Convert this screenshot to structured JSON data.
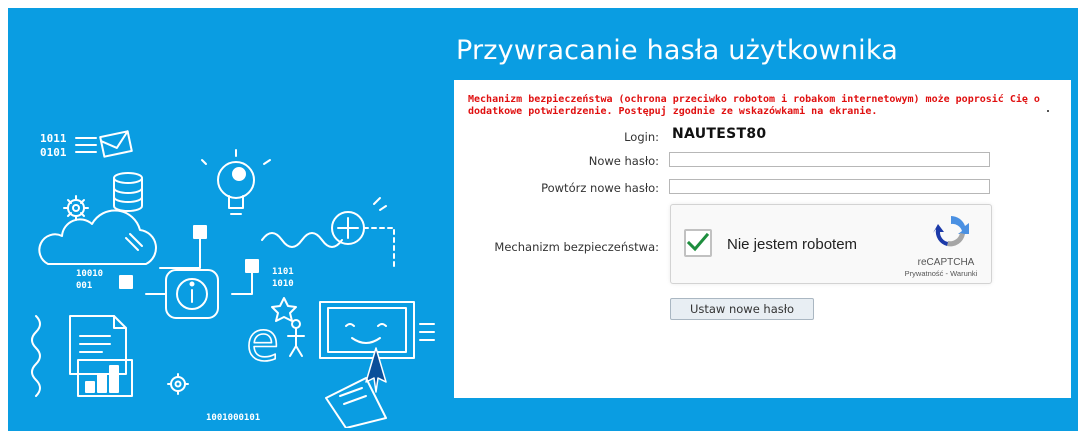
{
  "page": {
    "title": "Przywracanie hasła użytkownika"
  },
  "notice": {
    "text": "Mechanizm bezpieczeństwa (ochrona przeciwko robotom i robakom internetowym) może poprosić Cię o dodatkowe potwierdzenie. Postępuj zgodnie ze wskazówkami na ekranie."
  },
  "form": {
    "login_label": "Login:",
    "login_value": "NAUTEST80",
    "new_password_label": "Nowe hasło:",
    "new_password_value": "",
    "repeat_password_label": "Powtórz nowe hasło:",
    "repeat_password_value": "",
    "captcha_label": "Mechanizm bezpieczeństwa:",
    "submit_label": "Ustaw nowe hasło"
  },
  "captcha": {
    "checkbox_label": "Nie jestem robotem",
    "checked": true,
    "brand": "reCAPTCHA",
    "privacy_link": "Prywatność",
    "separator": " - ",
    "terms_link": "Warunki"
  },
  "illustration": {
    "binary_1": "1011",
    "binary_2": "0101",
    "binary_3": "10010",
    "binary_4": "001",
    "binary_5": "1101",
    "binary_6": "1010",
    "binary_7": "1001000101",
    "letter_e": "e"
  },
  "colors": {
    "banner": "#0a9de2",
    "notice": "#e01010",
    "check": "#1e8e3e"
  },
  "icons": [
    "envelope-icon",
    "database-icon",
    "lightbulb-icon",
    "gear-icon",
    "cloud-icon",
    "plus-circle-icon",
    "info-icon",
    "laptop-icon",
    "cursor-icon",
    "document-icon",
    "chart-icon",
    "recaptcha-icon",
    "checkmark-icon"
  ]
}
